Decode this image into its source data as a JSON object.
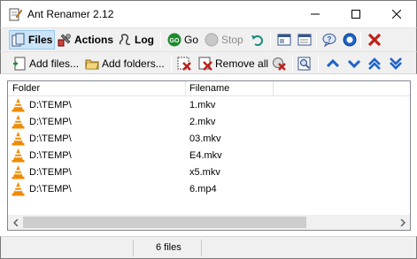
{
  "window": {
    "title": "Ant Renamer 2.12"
  },
  "toolbar_main": {
    "files_label": "Files",
    "actions_label": "Actions",
    "log_label": "Log",
    "go_label": "Go",
    "stop_label": "Stop"
  },
  "toolbar_list": {
    "add_files_label": "Add files...",
    "add_folders_label": "Add folders...",
    "remove_all_label": "Remove all"
  },
  "list": {
    "columns": [
      "Folder",
      "Filename"
    ],
    "rows": [
      {
        "folder": "D:\\TEMP\\",
        "filename": "1.mkv"
      },
      {
        "folder": "D:\\TEMP\\",
        "filename": "2.mkv"
      },
      {
        "folder": "D:\\TEMP\\",
        "filename": "03.mkv"
      },
      {
        "folder": "D:\\TEMP\\",
        "filename": "E4.mkv"
      },
      {
        "folder": "D:\\TEMP\\",
        "filename": "x5.mkv"
      },
      {
        "folder": "D:\\TEMP\\",
        "filename": "6.mp4"
      }
    ]
  },
  "status": {
    "count": "6 files"
  },
  "icons": {
    "app": "pencil-document-icon",
    "files": "files-icon",
    "actions": "actions-icon",
    "log": "log-icon",
    "go": "go-icon",
    "stop": "stop-icon",
    "undo": "undo-icon",
    "file_type": "vlc-cone-icon"
  },
  "colors": {
    "selected_tab": "#cce4f7",
    "accent_blue": "#1e63c8",
    "go_green": "#1f8a2e"
  }
}
